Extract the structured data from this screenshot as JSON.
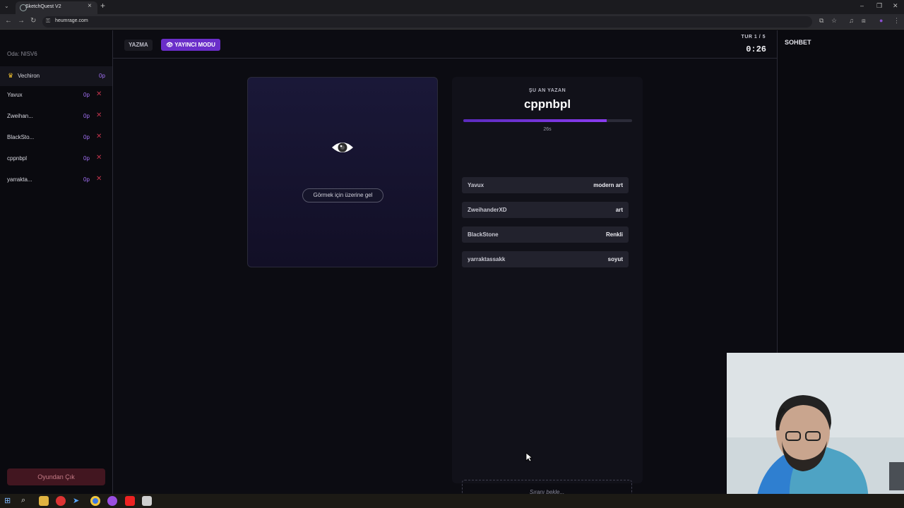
{
  "browser": {
    "tab_title": "SketchQuest V2",
    "url": "heumrage.com"
  },
  "sidebar": {
    "room": "Oda: NISV6",
    "host": {
      "name": "Vechiron",
      "points": "0p"
    },
    "players": [
      {
        "name": "Yavux",
        "points": "0p"
      },
      {
        "name": "Zweihan...",
        "points": "0p"
      },
      {
        "name": "BlackSto...",
        "points": "0p"
      },
      {
        "name": "cppnbpl",
        "points": "0p"
      },
      {
        "name": "yarrakta...",
        "points": "0p"
      }
    ],
    "leave_label": "Oyundan Çık"
  },
  "header": {
    "tab_yazma": "YAZMA",
    "tab_streamer": "YAYINCI MODU",
    "round": "TUR 1 / 5",
    "timer": "0:26"
  },
  "chat": {
    "title": "SOHBET"
  },
  "canvas": {
    "hover_hint": "Görmek için üzerine gel"
  },
  "writing": {
    "label": "ŞU AN YAZAN",
    "writer": "cppnbpl",
    "progress_fraction": 0.85,
    "seconds_left": "26s",
    "answers": [
      {
        "name": "Yavux",
        "word": "modern art"
      },
      {
        "name": "ZweihanderXD",
        "word": "art"
      },
      {
        "name": "BlackStone",
        "word": "Renkli"
      },
      {
        "name": "yarraktassakk",
        "word": "soyut"
      }
    ],
    "wait_text": "Sıranı bekle..."
  }
}
